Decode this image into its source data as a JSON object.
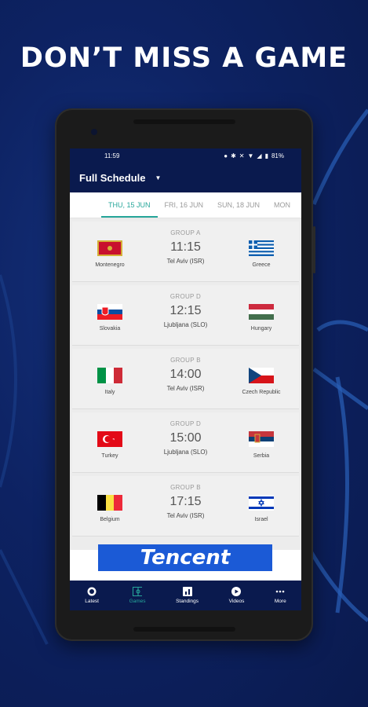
{
  "headline": "DON’T MISS A GAME",
  "status": {
    "time": "11:59",
    "battery": "81%"
  },
  "appbar": {
    "title": "Full Schedule"
  },
  "tabs": [
    "THU, 15 JUN",
    "FRI, 16 JUN",
    "SUN, 18 JUN",
    "MON"
  ],
  "games": [
    {
      "group": "GROUP A",
      "time": "11:15",
      "venue": "Tel Aviv (ISR)",
      "home": "Montenegro",
      "away": "Greece"
    },
    {
      "group": "GROUP D",
      "time": "12:15",
      "venue": "Ljubljana (SLO)",
      "home": "Slovakia",
      "away": "Hungary"
    },
    {
      "group": "GROUP B",
      "time": "14:00",
      "venue": "Tel Aviv (ISR)",
      "home": "Italy",
      "away": "Czech Republic"
    },
    {
      "group": "GROUP D",
      "time": "15:00",
      "venue": "Ljubljana (SLO)",
      "home": "Turkey",
      "away": "Serbia"
    },
    {
      "group": "GROUP B",
      "time": "17:15",
      "venue": "Tel Aviv (ISR)",
      "home": "Belgium",
      "away": "Israel"
    }
  ],
  "banner": {
    "text": "Tencent"
  },
  "nav": [
    "Latest",
    "Games",
    "Standings",
    "Videos",
    "More"
  ],
  "colors": {
    "accent": "#26a69a",
    "navy": "#0a1a4e",
    "banner": "#1b5ad6"
  }
}
